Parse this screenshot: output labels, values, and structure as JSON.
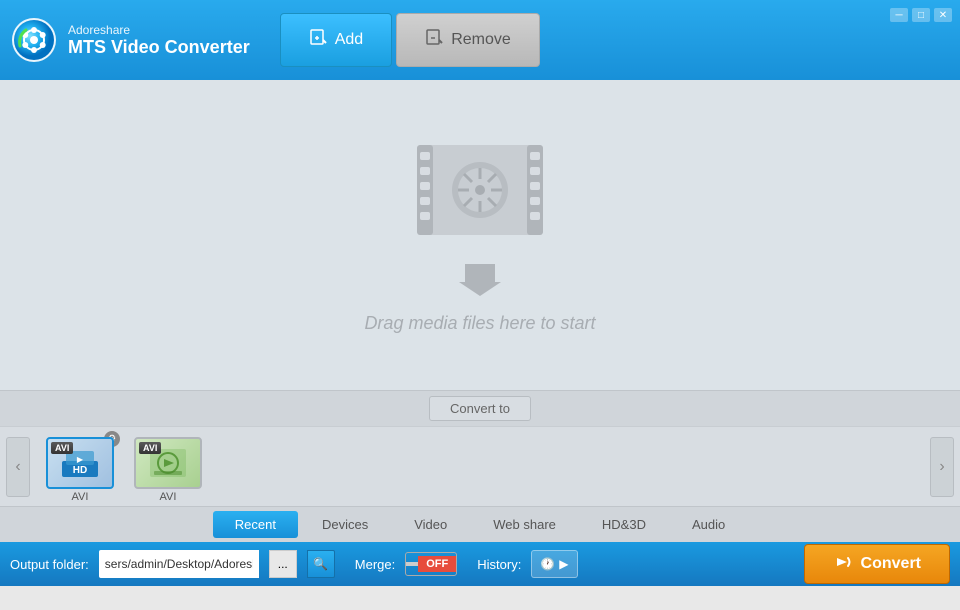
{
  "app": {
    "brand": "Adoreshare",
    "title": "MTS Video Converter"
  },
  "toolbar": {
    "add_label": "Add",
    "remove_label": "Remove"
  },
  "window_controls": {
    "minimize": "─",
    "maximize": "□",
    "close": "✕"
  },
  "drop_area": {
    "text": "Drag media files here to start"
  },
  "convert_to": {
    "label": "Convert to"
  },
  "formats": [
    {
      "id": 1,
      "label": "AVI",
      "badge": "AVI",
      "type": "avi1",
      "selected": true
    },
    {
      "id": 2,
      "label": "AVI",
      "badge": "AVI",
      "type": "avi2",
      "selected": false
    }
  ],
  "format_tabs": [
    {
      "id": "recent",
      "label": "Recent",
      "active": true
    },
    {
      "id": "devices",
      "label": "Devices",
      "active": false
    },
    {
      "id": "video",
      "label": "Video",
      "active": false
    },
    {
      "id": "webshare",
      "label": "Web share",
      "active": false
    },
    {
      "id": "hd3d",
      "label": "HD&3D",
      "active": false
    },
    {
      "id": "audio",
      "label": "Audio",
      "active": false
    }
  ],
  "bottom_bar": {
    "output_label": "Output folder:",
    "output_path": "sers/admin/Desktop/Adoreshare",
    "merge_label": "Merge:",
    "toggle_on": "",
    "toggle_off": "OFF",
    "history_label": "History:",
    "convert_label": "Convert"
  }
}
